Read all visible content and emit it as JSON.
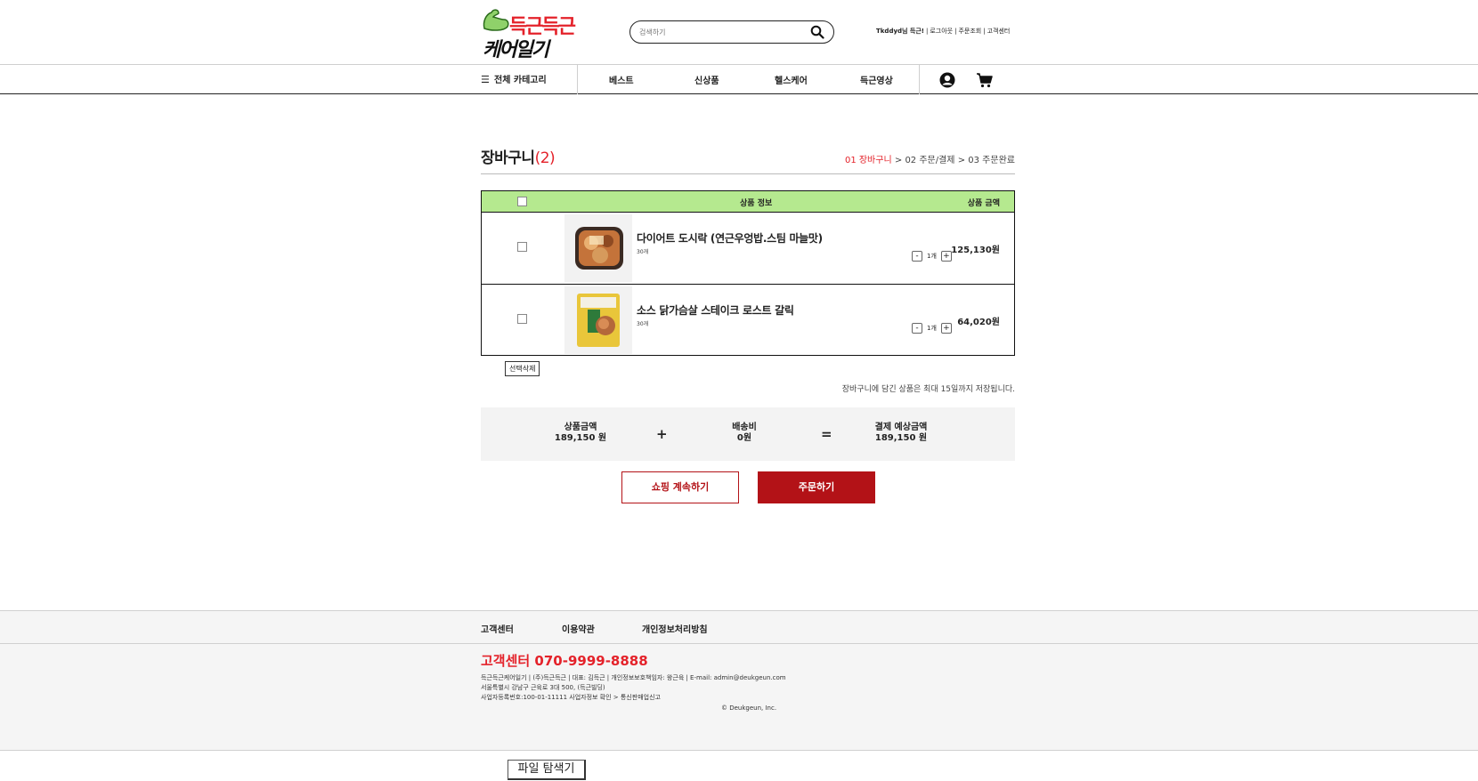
{
  "header": {
    "logo_line1": "득근득근",
    "logo_line2": "케어일기",
    "search_placeholder": "검색하기",
    "top_links": [
      "Tkddyd님 득근!",
      "로그아웃",
      "주문조회",
      "고객센터"
    ],
    "brand_color": "#e4222a"
  },
  "nav": {
    "all_category": "전체 카테고리",
    "items": [
      "베스트",
      "신상품",
      "헬스케어",
      "득근영상"
    ]
  },
  "cart": {
    "title": "장바구니",
    "count": "(2)",
    "steps": {
      "step1": "01 장바구니",
      "step2": "02 주문/결제",
      "step3": "03 주문완료",
      "arrow": ">"
    },
    "headers": {
      "info": "상품 정보",
      "price": "상품 금액"
    },
    "header_bg": "#b5e98f",
    "items": [
      {
        "name": "다이어트 도시락 (연근우엉밥.스팀 마늘맛)",
        "pack": "30개",
        "qty": "1개",
        "minus": "-",
        "plus": "+",
        "price": "125,130원"
      },
      {
        "name": "소스 닭가슴살 스테이크 로스트 갈릭",
        "pack": "30개",
        "qty": "1개",
        "minus": "-",
        "plus": "+",
        "price": "64,020원"
      }
    ],
    "delete_selected": "선택삭제",
    "note": "장바구니에 담긴 상품은 최대 15일까지 저장됩니다."
  },
  "summary": {
    "product_label": "상품금액",
    "product_value": "189,150 원",
    "plus": "+",
    "shipping_label": "배송비",
    "shipping_value": "0원",
    "equals": "=",
    "total_label": "결제 예상금액",
    "total_value": "189,150 원"
  },
  "buttons": {
    "continue": "쇼핑 계속하기",
    "order": "주문하기",
    "order_color": "#b31217"
  },
  "footer": {
    "links": [
      "고객센터",
      "이용약관",
      "개인정보처리방침"
    ],
    "cs_phone": "고객센터 070-9999-8888",
    "line1": "득근득근케어일기 | (주)득근득근 | 대표: 김득근 | 개인정보보호책임자: 왕근육 | E-mail: admin@deukgeun.com",
    "line2": "서울특별시 강남구 근육로 3대 500, (득근빌딩)",
    "line3": "사업자등록번호:100-01-11111 사업자정보 확인 > 통신판매업신고",
    "copyright": "© Deukgeun, Inc."
  },
  "taskbar": {
    "file_explorer": "파일 탐색기"
  }
}
